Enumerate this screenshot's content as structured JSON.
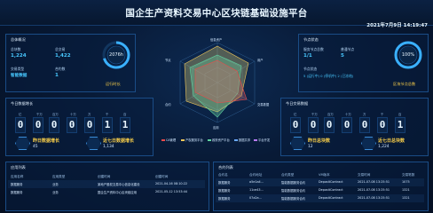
{
  "header": {
    "title": "国企生产资料交易中心区块链基础设施平台",
    "datetime": "2021年7月9日 14:19:47"
  },
  "left_panel": {
    "title": "总体概况",
    "stats": [
      {
        "label": "总块数",
        "value": "1,224"
      },
      {
        "label": "总交易",
        "value": "1,422"
      },
      {
        "label": "交易类型",
        "value": "智能数据"
      },
      {
        "label": "合约数",
        "value": "1"
      }
    ],
    "ring_value": "2076h",
    "ring_caption": "运行时长"
  },
  "radar": {
    "axes": [
      "信息资产",
      "用户",
      "交易数据",
      "应用",
      "合约",
      "节点"
    ],
    "legend": [
      "CA管理",
      "产权服务平台",
      "政府资产平台",
      "数据共享",
      "平台开发"
    ],
    "legend_colors": [
      "#e94b4b",
      "#f0c75a",
      "#5fd39f",
      "#6aa8ff",
      "#b97cff"
    ]
  },
  "right_panel": {
    "title": "节点状态",
    "stats": [
      {
        "label": "服务节点总数",
        "value": "1/1"
      },
      {
        "label": "普通节点",
        "value": "5"
      }
    ],
    "status_label": "节点状态",
    "status_text": "5 (运行中) 0 (停机中) 2 (已冻结)",
    "ring_value": "100%",
    "ring_caption": "区块节点总数"
  },
  "mid_left": {
    "title": "今日数据增长",
    "digits": [
      "0",
      "0",
      "0",
      "0",
      "0",
      "1",
      "1"
    ],
    "digit_labels": [
      "亿",
      "千万",
      "百万",
      "十万",
      "万",
      "千",
      "百"
    ],
    "stat1": {
      "label": "昨日数据增长",
      "value": "45"
    },
    "stat2": {
      "label": "近七日数据增长",
      "value": "1,134"
    }
  },
  "mid_right": {
    "title": "今日交易数据",
    "digits": [
      "0",
      "0",
      "0",
      "0",
      "0",
      "0",
      "1"
    ],
    "digit_labels": [
      "亿",
      "千万",
      "百万",
      "十万",
      "万",
      "千",
      "百"
    ],
    "stat1": {
      "label": "昨日总块数",
      "value": "12"
    },
    "stat2": {
      "label": "近七日总块数",
      "value": "1,224"
    }
  },
  "bottom_left": {
    "title": "应用列表",
    "headers": [
      "应用名称",
      "应用类型",
      "创建时间",
      "创建时间"
    ],
    "rows": [
      {
        "c1": "数据服务",
        "c2": "业务",
        "c3": "某地产股权交易中心信息化建设",
        "c4": "2021-04-16 08:10:22"
      },
      {
        "c1": "数据服务",
        "c2": "业务",
        "c3": "国企生产资料中心区块链应用",
        "c4": "2021-05-12 13:53:44"
      }
    ]
  },
  "bottom_right": {
    "title": "合约列表",
    "headers": [
      "合约名",
      "合约地址",
      "合约类型",
      "VM版本",
      "交易时间",
      "交易笔数"
    ],
    "rows": [
      {
        "c1": "数据服务",
        "c2": "a5e1a4...",
        "c3": "智能数据服务合约",
        "c4": "DepositContract",
        "c5": "2021-07-08 13:25:51",
        "c6": "1075"
      },
      {
        "c1": "数据服务",
        "c2": "11ce43...",
        "c3": "智能数据服务合约",
        "c4": "DepositContract",
        "c5": "2021-07-08 13:25:51",
        "c6": "1321"
      },
      {
        "c1": "数据服务",
        "c2": "07a2a...",
        "c3": "智能数据服务合约",
        "c4": "DepositContract",
        "c5": "2021-07-08 13:25:51",
        "c6": "1321"
      }
    ]
  }
}
